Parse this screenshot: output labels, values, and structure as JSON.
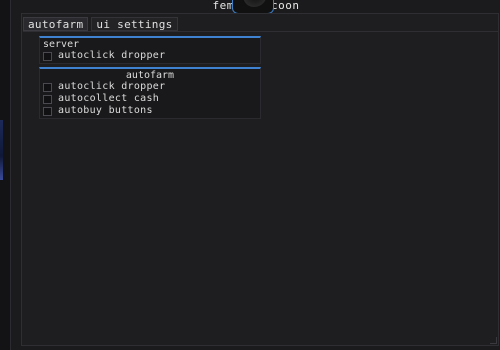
{
  "window": {
    "title_left": "femb",
    "title_right": "coon"
  },
  "tabs": [
    {
      "label": "autofarm",
      "active": true
    },
    {
      "label": "ui settings",
      "active": false
    }
  ],
  "groups": [
    {
      "title": "server",
      "items": [
        {
          "label": "autoclick dropper",
          "checked": false
        }
      ]
    },
    {
      "title": "autofarm",
      "items": [
        {
          "label": "autoclick dropper",
          "checked": false
        },
        {
          "label": "autocollect cash",
          "checked": false
        },
        {
          "label": "autobuy buttons",
          "checked": false
        }
      ]
    }
  ],
  "colors": {
    "accent": "#3f82d2",
    "window_bg": "#1b1b1d"
  },
  "icons": {
    "logo": "record-disk-logo-icon"
  }
}
